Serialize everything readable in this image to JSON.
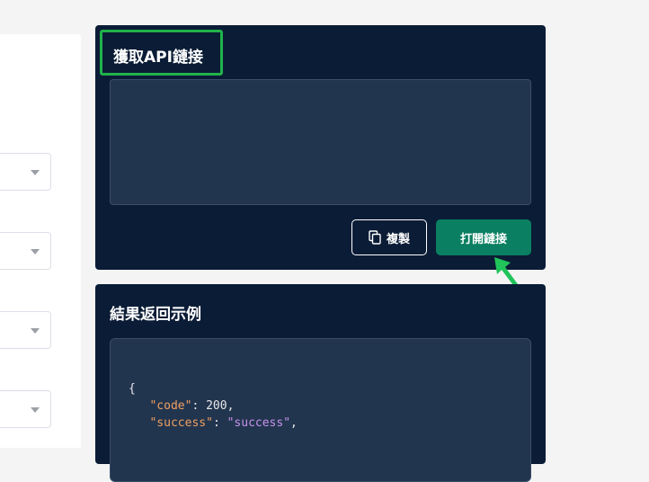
{
  "api_card": {
    "title": "獲取API鏈接",
    "url_value": "",
    "copy_label": "複製",
    "open_label": "打開鏈接"
  },
  "result_card": {
    "title": "結果返回示例",
    "code": {
      "open_brace": "{",
      "line1_key": "\"code\"",
      "line1_sep": ": ",
      "line1_value": "200",
      "line1_end": ",",
      "line2_key": "\"success\"",
      "line2_sep": ": ",
      "line2_value": "\"success\"",
      "line2_end": ","
    }
  },
  "colors": {
    "card_bg": "#0b1c36",
    "highlight": "#21b24a",
    "primary_button": "#0a7f62"
  },
  "icons": {
    "copy": "copy-icon",
    "select_caret": "chevron-down-icon",
    "annotation": "arrow-annotation-icon"
  }
}
